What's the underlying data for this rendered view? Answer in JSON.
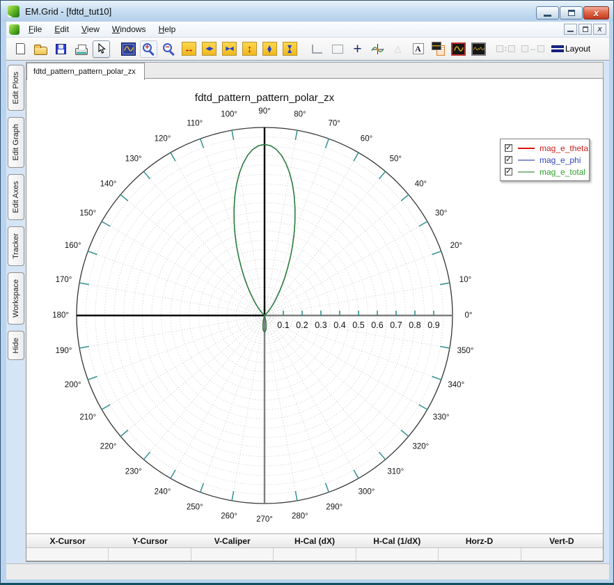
{
  "window": {
    "title": "EM.Grid - [fdtd_tut10]",
    "controls": [
      "minimize",
      "restore",
      "close"
    ]
  },
  "menu": {
    "items": [
      "File",
      "Edit",
      "View",
      "Windows",
      "Help"
    ],
    "mdi_controls": [
      "minimize",
      "restore",
      "close"
    ]
  },
  "toolbar": {
    "layout_label": "Layout",
    "items": [
      {
        "name": "new-file-icon",
        "kind": "page"
      },
      {
        "name": "open-file-icon",
        "kind": "folder"
      },
      {
        "name": "save-icon",
        "kind": "floppy"
      },
      {
        "name": "print-icon",
        "kind": "printer"
      },
      {
        "name": "pointer-tool-icon",
        "kind": "pointer",
        "framed": true
      },
      {
        "name": "sep"
      },
      {
        "name": "zoom-window-icon",
        "kind": "plotbox"
      },
      {
        "name": "zoom-in-icon",
        "kind": "zoomin",
        "lite": true
      },
      {
        "name": "zoom-out-icon",
        "kind": "zoomout"
      },
      {
        "name": "h-full-scale-icon",
        "kind": "yel-h-red"
      },
      {
        "name": "h-expand-icon",
        "kind": "yel-h-out"
      },
      {
        "name": "h-compress-icon",
        "kind": "yel-h-in"
      },
      {
        "name": "v-full-scale-icon",
        "kind": "yel-v-red"
      },
      {
        "name": "v-expand-icon",
        "kind": "yel-v-out"
      },
      {
        "name": "v-compress-icon",
        "kind": "yel-v-in"
      },
      {
        "name": "sep"
      },
      {
        "name": "axes-frame-icon",
        "kind": "axes"
      },
      {
        "name": "rect-zoom-icon",
        "kind": "rect"
      },
      {
        "name": "crosshair-icon",
        "kind": "cross"
      },
      {
        "name": "tracker-icon",
        "kind": "tracker"
      },
      {
        "name": "slope-tool-icon",
        "kind": "tri",
        "disabled": true
      },
      {
        "name": "text-tool-icon",
        "kind": "textA"
      },
      {
        "name": "plot-report-icon",
        "kind": "report"
      },
      {
        "name": "single-plot-icon",
        "kind": "plotred"
      },
      {
        "name": "multi-plot-icon",
        "kind": "plotmulti"
      },
      {
        "name": "sep"
      },
      {
        "name": "split-vertical-icon",
        "kind": "splitv",
        "disabled": true
      },
      {
        "name": "sep"
      },
      {
        "name": "split-horizontal-icon",
        "kind": "splith",
        "disabled": true
      },
      {
        "name": "sep"
      },
      {
        "name": "layout-icon",
        "kind": "layout"
      }
    ]
  },
  "sidebar": {
    "items": [
      "Edit Plots",
      "Edit Graph",
      "Edit Axes",
      "Tracker",
      "Workspace",
      "Hide"
    ]
  },
  "tab": {
    "label": "fdtd_pattern_pattern_polar_zx"
  },
  "legend": {
    "entries": [
      {
        "label": "mag_e_theta",
        "line_color": "#e01010",
        "text_color": "#cc2020",
        "checked": true
      },
      {
        "label": "mag_e_phi",
        "line_color": "#8890cc",
        "text_color": "#3344bb",
        "checked": true
      },
      {
        "label": "mag_e_total",
        "line_color": "#8cba8c",
        "text_color": "#2e9e2e",
        "checked": true
      }
    ]
  },
  "cursor_table": {
    "columns": [
      "X-Cursor",
      "Y-Cursor",
      "V-Caliper",
      "H-Cal (dX)",
      "H-Cal (1/dX)",
      "Horz-D",
      "Vert-D"
    ],
    "values": [
      "",
      "",
      "",
      "",
      "",
      "",
      ""
    ]
  },
  "chart_data": {
    "type": "polar",
    "title": "fdtd_pattern_pattern_polar_zx",
    "radial_max": 1.0,
    "radial_tick_step": 0.1,
    "radial_tick_labels": [
      "0.1",
      "0.2",
      "0.3",
      "0.4",
      "0.5",
      "0.6",
      "0.7",
      "0.8",
      "0.9"
    ],
    "angle_tick_step_deg": 10,
    "angle_labels": [
      "0°",
      "10°",
      "20°",
      "30°",
      "40°",
      "50°",
      "60°",
      "70°",
      "80°",
      "90°",
      "100°",
      "110°",
      "120°",
      "130°",
      "140°",
      "150°",
      "160°",
      "170°",
      "180°",
      "190°",
      "200°",
      "210°",
      "220°",
      "230°",
      "240°",
      "250°",
      "260°",
      "270°",
      "280°",
      "290°",
      "300°",
      "310°",
      "320°",
      "330°",
      "340°",
      "350°"
    ],
    "grid": {
      "circle_step": 0.05,
      "style": "dotted",
      "color": "#c9c9c9",
      "tick_color": "#2f9090",
      "axis_dark": "#000000",
      "axis_gray": "#7f7f7f"
    },
    "series": [
      {
        "name": "mag_e_theta",
        "curve_color": "#e01010",
        "visible_trace": false,
        "lobes": []
      },
      {
        "name": "mag_e_phi",
        "curve_color": "#8890cc",
        "visible_trace": false,
        "lobes": []
      },
      {
        "name": "mag_e_total",
        "curve_color": "#2b7a40",
        "visible_trace": true,
        "lobes": [
          [
            [
              46,
              0.024
            ],
            [
              48,
              0.035
            ],
            [
              50,
              0.049
            ],
            [
              52,
              0.066
            ],
            [
              54,
              0.088
            ],
            [
              56,
              0.116
            ],
            [
              58,
              0.149
            ],
            [
              60,
              0.187
            ],
            [
              62,
              0.231
            ],
            [
              64,
              0.28
            ],
            [
              66,
              0.336
            ],
            [
              68,
              0.396
            ],
            [
              70,
              0.459
            ],
            [
              72,
              0.524
            ],
            [
              74,
              0.589
            ],
            [
              76,
              0.653
            ],
            [
              78,
              0.714
            ],
            [
              80,
              0.769
            ],
            [
              82,
              0.817
            ],
            [
              84,
              0.857
            ],
            [
              86,
              0.886
            ],
            [
              88,
              0.904
            ],
            [
              90,
              0.91
            ],
            [
              92,
              0.904
            ],
            [
              94,
              0.886
            ],
            [
              96,
              0.857
            ],
            [
              98,
              0.817
            ],
            [
              100,
              0.769
            ],
            [
              102,
              0.714
            ],
            [
              104,
              0.653
            ],
            [
              106,
              0.589
            ],
            [
              108,
              0.524
            ],
            [
              110,
              0.459
            ],
            [
              112,
              0.396
            ],
            [
              114,
              0.336
            ],
            [
              116,
              0.28
            ],
            [
              118,
              0.231
            ],
            [
              120,
              0.187
            ],
            [
              122,
              0.149
            ],
            [
              124,
              0.116
            ],
            [
              126,
              0.088
            ],
            [
              128,
              0.066
            ],
            [
              130,
              0.049
            ],
            [
              132,
              0.035
            ],
            [
              134,
              0.024
            ]
          ],
          [
            [
              254,
              0
            ],
            [
              256,
              0.018
            ],
            [
              258,
              0.034
            ],
            [
              260,
              0.049
            ],
            [
              262,
              0.062
            ],
            [
              264,
              0.073
            ],
            [
              266,
              0.081
            ],
            [
              268,
              0.086
            ],
            [
              270,
              0.088
            ],
            [
              272,
              0.086
            ],
            [
              274,
              0.081
            ],
            [
              276,
              0.073
            ],
            [
              278,
              0.062
            ],
            [
              280,
              0.049
            ],
            [
              282,
              0.034
            ],
            [
              284,
              0.018
            ],
            [
              286,
              0
            ]
          ]
        ]
      }
    ]
  },
  "status": {
    "text": ""
  }
}
